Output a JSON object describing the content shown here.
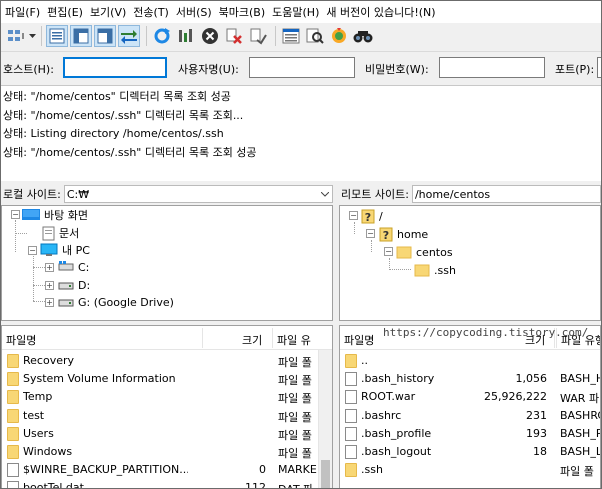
{
  "menu": [
    "파일(F)",
    "편집(E)",
    "보기(V)",
    "전송(T)",
    "서버(S)",
    "북마크(B)",
    "도움말(H)",
    "새 버전이 있습니다!(N)"
  ],
  "toolbar": {
    "icons": [
      "site-manager-icon",
      "dropdown-arrow-icon",
      "toggle-log-icon",
      "toggle-local-tree-icon",
      "toggle-remote-tree-icon",
      "toggle-queue-icon",
      "refresh-icon",
      "process-queue-icon",
      "cancel-icon",
      "disconnect-icon",
      "reconnect-icon",
      "filter-icon",
      "compare-icon",
      "sync-browse-icon",
      "find-files-icon"
    ]
  },
  "quickconnect": {
    "host_label": "호스트(H):",
    "user_label": "사용자명(U):",
    "pass_label": "비밀번호(W):",
    "port_label": "포트(P):",
    "host_value": "",
    "user_value": "",
    "pass_value": "",
    "port_value": ""
  },
  "log": [
    {
      "status": "상태:",
      "text": "\"/home/centos\" 디렉터리 목록 조회 성공"
    },
    {
      "status": "상태:",
      "text": "\"/home/centos/.ssh\" 디렉터리 목록 조회..."
    },
    {
      "status": "상태:",
      "text": "Listing directory /home/centos/.ssh"
    },
    {
      "status": "상태:",
      "text": "\"/home/centos/.ssh\" 디렉터리 목록 조회 성공"
    }
  ],
  "local": {
    "site_label": "로컬 사이트:",
    "path": "C:₩",
    "tree": [
      {
        "label": "바탕 화면",
        "icon": "desktop-icon"
      },
      {
        "label": "문서",
        "icon": "documents-icon"
      },
      {
        "label": "내 PC",
        "icon": "computer-icon"
      },
      {
        "label": "C:",
        "icon": "drive-c-icon"
      },
      {
        "label": "D:",
        "icon": "drive-icon"
      },
      {
        "label": "G: (Google Drive)",
        "icon": "drive-icon"
      }
    ],
    "columns": [
      "파일명",
      "크기",
      "파일 유"
    ],
    "files": [
      {
        "name": "Recovery",
        "size": "",
        "type": "파일 폴",
        "icon": "folder"
      },
      {
        "name": "System Volume Information",
        "size": "",
        "type": "파일 폴",
        "icon": "folder"
      },
      {
        "name": "Temp",
        "size": "",
        "type": "파일 폴",
        "icon": "folder"
      },
      {
        "name": "test",
        "size": "",
        "type": "파일 폴",
        "icon": "folder"
      },
      {
        "name": "Users",
        "size": "",
        "type": "파일 폴",
        "icon": "folder"
      },
      {
        "name": "Windows",
        "size": "",
        "type": "파일 폴",
        "icon": "folder"
      },
      {
        "name": "$WINRE_BACKUP_PARTITION....",
        "size": "0",
        "type": "MARKE",
        "icon": "doc"
      },
      {
        "name": "bootTel.dat",
        "size": "112",
        "type": "DAT 파",
        "icon": "doc"
      }
    ]
  },
  "remote": {
    "site_label": "리모트 사이트:",
    "path": "/home/centos",
    "tree": [
      {
        "label": "/",
        "icon": "unknown-folder-icon"
      },
      {
        "label": "home",
        "icon": "unknown-folder-icon"
      },
      {
        "label": "centos",
        "icon": "folder-icon"
      },
      {
        "label": ".ssh",
        "icon": "folder-icon"
      }
    ],
    "columns": [
      "파일명",
      "크기",
      "파일 유형"
    ],
    "files": [
      {
        "name": "..",
        "size": "",
        "type": "",
        "icon": "folder"
      },
      {
        "name": ".bash_history",
        "size": "1,056",
        "type": "BASH_H",
        "icon": "doc"
      },
      {
        "name": "ROOT.war",
        "size": "25,926,222",
        "type": "WAR 파",
        "icon": "doc"
      },
      {
        "name": ".bashrc",
        "size": "231",
        "type": "BASHRC",
        "icon": "doc"
      },
      {
        "name": ".bash_profile",
        "size": "193",
        "type": "BASH_P",
        "icon": "doc"
      },
      {
        "name": ".bash_logout",
        "size": "18",
        "type": "BASH_L",
        "icon": "doc"
      },
      {
        "name": ".ssh",
        "size": "",
        "type": "파일 폴",
        "icon": "folder"
      }
    ]
  },
  "watermark": "https://copycoding.tistory.com/",
  "colors": {
    "accent": "#0078d7",
    "folder": "#f8d775",
    "selected": "#cce4f7"
  }
}
